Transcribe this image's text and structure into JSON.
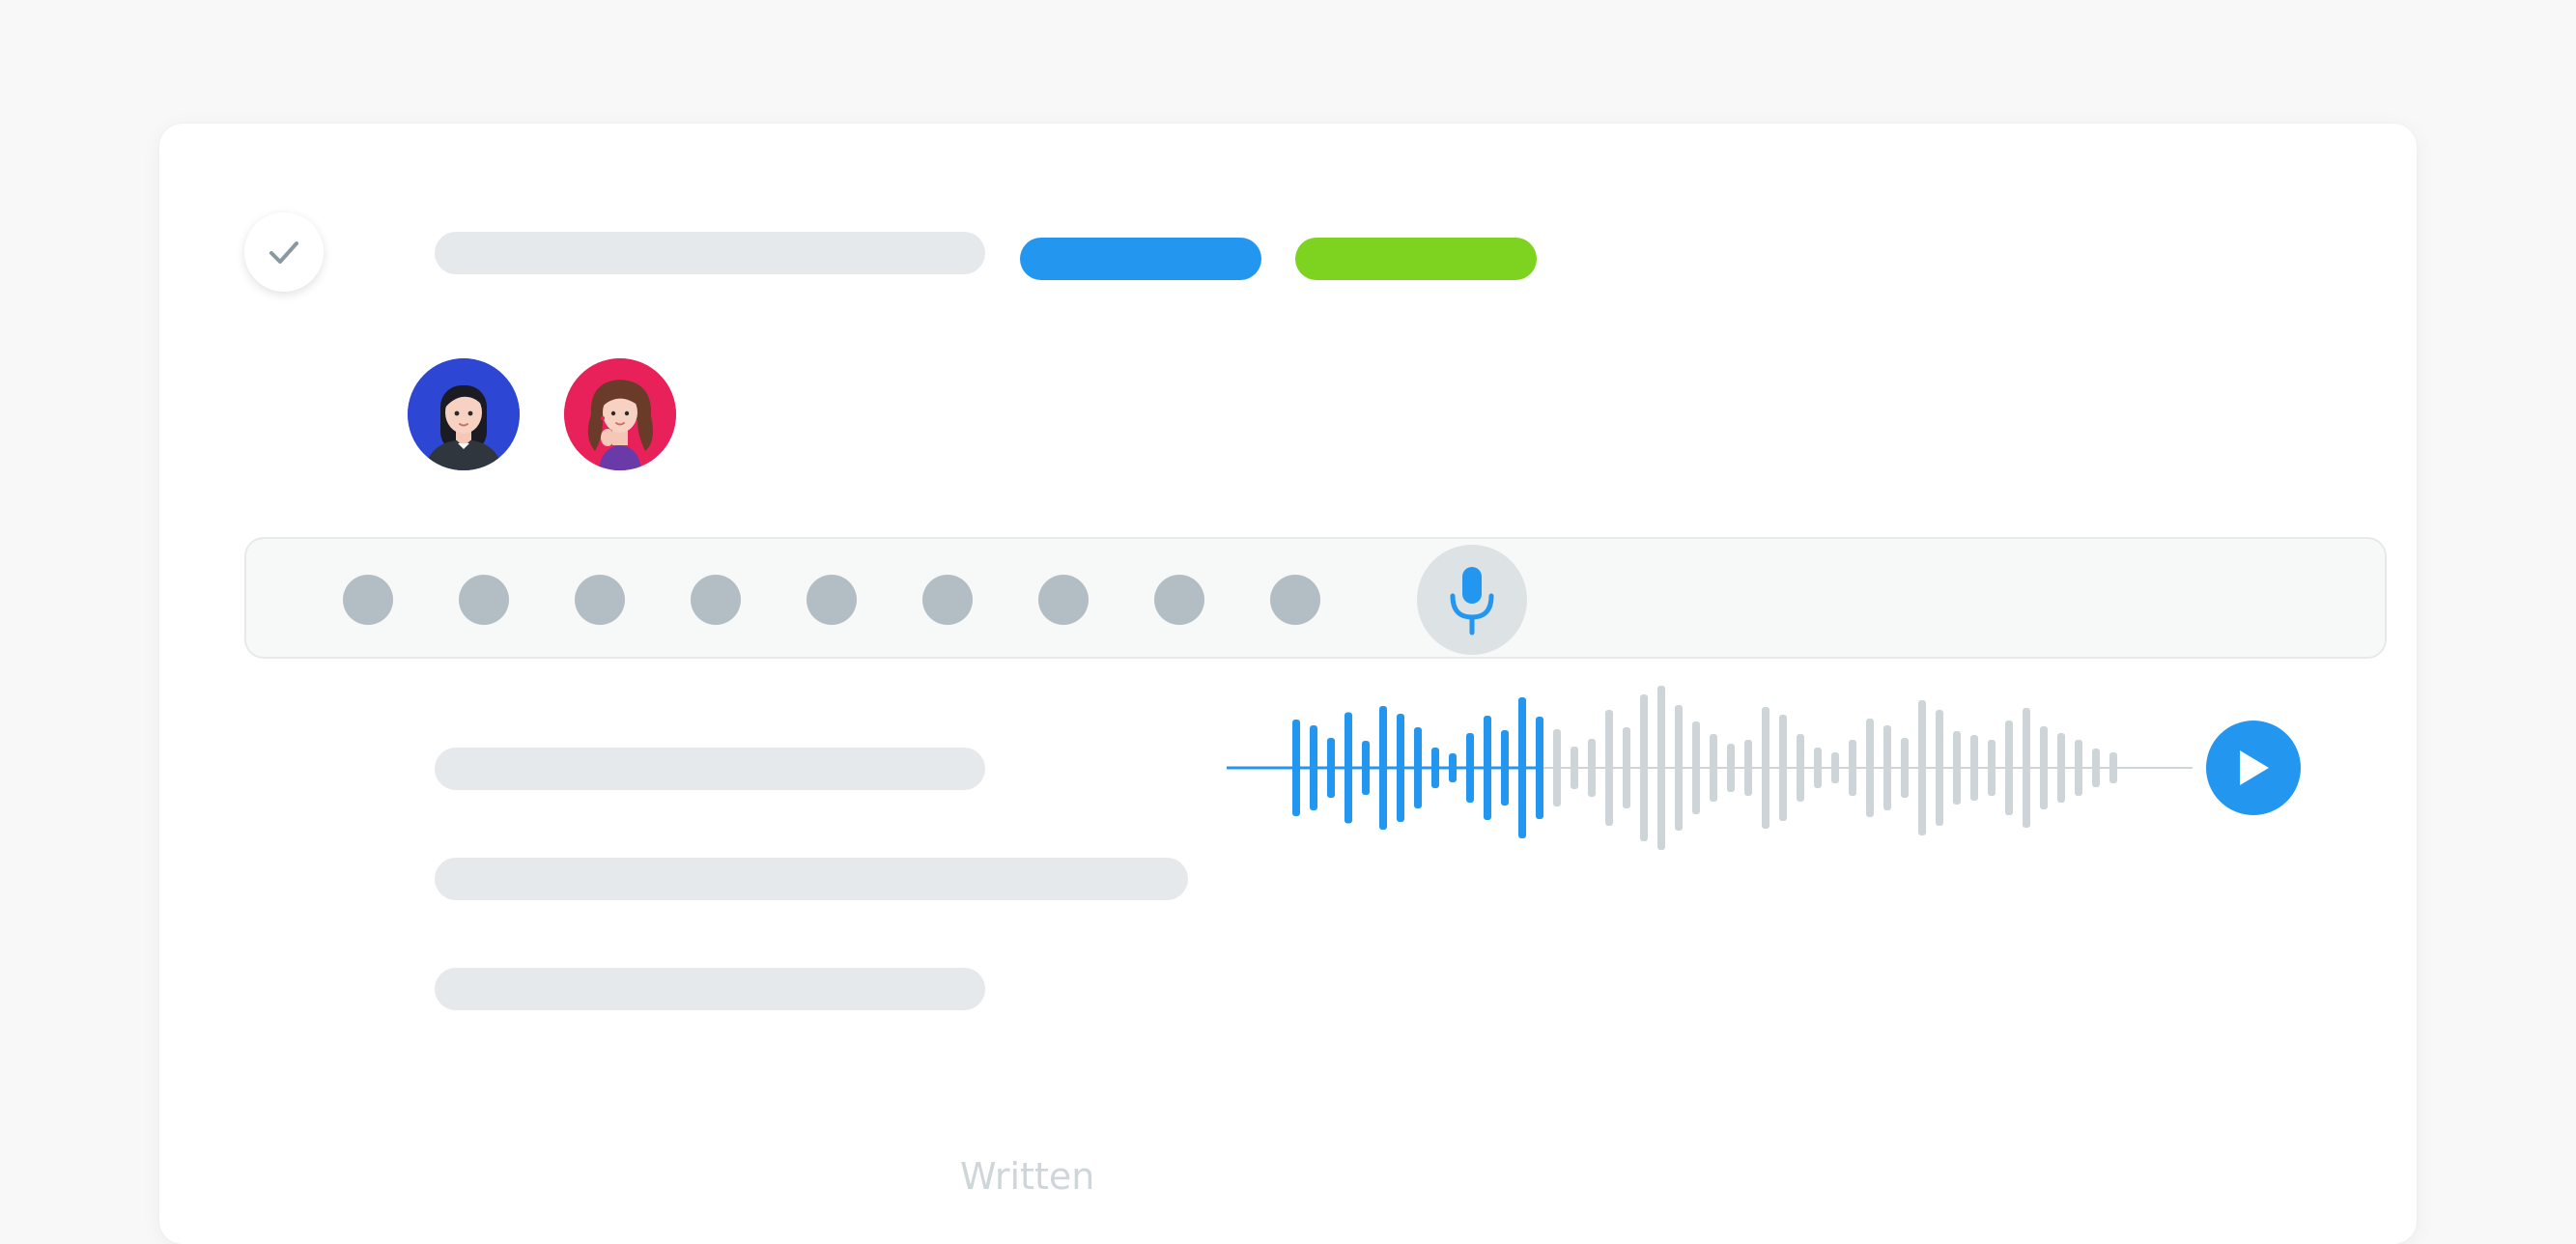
{
  "colors": {
    "background": "#f8f8f8",
    "card": "#ffffff",
    "placeholder_bar": "#e6e9eb",
    "tag_blue": "#2396ef",
    "tag_green": "#7ed321",
    "dot": "#b3bec4",
    "mic_bg": "#dde2e5",
    "wave_played": "#2396ef",
    "wave_unplayed": "#cdd5d8",
    "play_button": "#2396ef"
  },
  "header": {
    "check_icon": "checkmark-icon",
    "tags": [
      {
        "color": "#2396ef"
      },
      {
        "color": "#7ed321"
      }
    ]
  },
  "participants": [
    {
      "icon": "avatar-woman-dark-hair",
      "bg": "#2d47d4"
    },
    {
      "icon": "avatar-woman-brown-hair",
      "bg": "#e8215a"
    }
  ],
  "recording": {
    "dot_count": 9,
    "mic_icon": "microphone-icon"
  },
  "player": {
    "play_icon": "play-icon",
    "progress": 0.3
  },
  "footer": {
    "label": "Written"
  }
}
